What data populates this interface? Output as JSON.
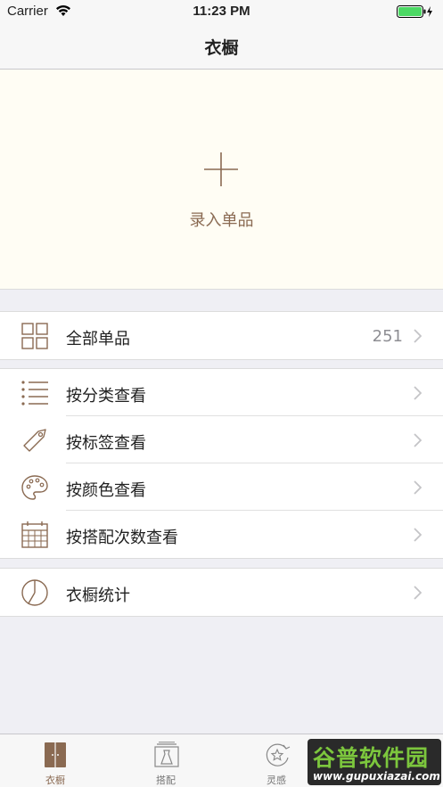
{
  "status_bar": {
    "carrier": "Carrier",
    "time": "11:23 PM"
  },
  "nav": {
    "title": "衣橱"
  },
  "add_item": {
    "label": "录入单品"
  },
  "all_items": {
    "label": "全部单品",
    "count": "251"
  },
  "browse": [
    {
      "label": "按分类查看"
    },
    {
      "label": "按标签查看"
    },
    {
      "label": "按颜色查看"
    },
    {
      "label": "按搭配次数查看"
    }
  ],
  "stats": {
    "label": "衣橱统计"
  },
  "tabs": [
    {
      "label": "衣橱",
      "active": true
    },
    {
      "label": "搭配"
    },
    {
      "label": "灵感"
    }
  ],
  "watermark": {
    "main": "谷普软件园",
    "url": "www.gupuxiazai.com"
  },
  "colors": {
    "accent": "#8a6a52",
    "background": "#efeff4",
    "panel": "#fffdf4"
  }
}
